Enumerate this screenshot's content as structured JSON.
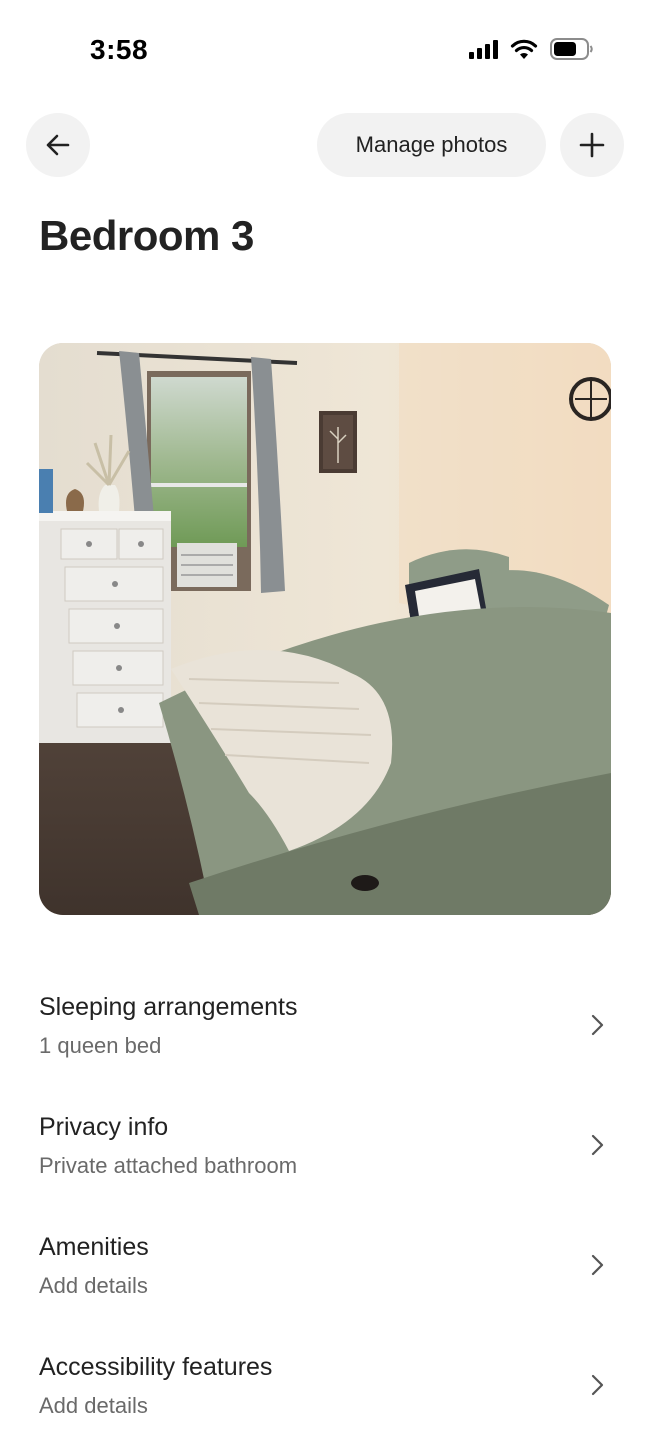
{
  "status_bar": {
    "time": "3:58"
  },
  "header": {
    "back_icon": "arrow-left-icon",
    "manage_photos_label": "Manage photos",
    "add_icon": "plus-icon"
  },
  "page": {
    "title": "Bedroom 3"
  },
  "photo": {
    "description_icon": "bedroom-photo"
  },
  "details": [
    {
      "title": "Sleeping arrangements",
      "subtitle": "1 queen bed"
    },
    {
      "title": "Privacy info",
      "subtitle": "Private attached bathroom"
    },
    {
      "title": "Amenities",
      "subtitle": "Add details"
    },
    {
      "title": "Accessibility features",
      "subtitle": "Add details"
    }
  ],
  "colors": {
    "text_primary": "#222222",
    "text_secondary": "#6a6a6a",
    "button_bg": "#f2f2f2"
  }
}
